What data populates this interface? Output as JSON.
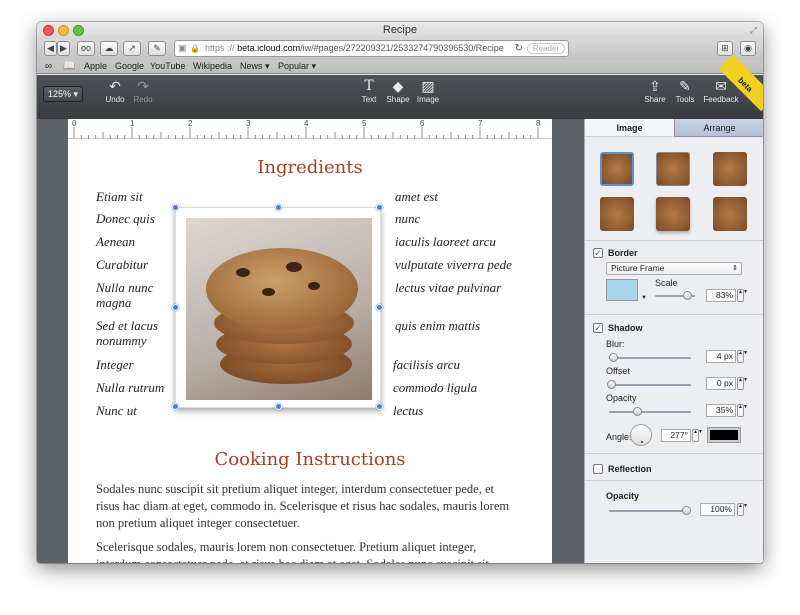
{
  "window": {
    "title": "Recipe"
  },
  "browser": {
    "url_scheme": "https",
    "url_host": "beta.icloud.com",
    "url_path": "/iw/#pages/272209321/2533274790396530/Recipe",
    "reader_label": "Reader"
  },
  "bookmarks": [
    "Apple",
    "Google",
    "YouTube",
    "Wikipedia",
    "News ▾",
    "Popular ▾"
  ],
  "toolbar": {
    "zoom": "125% ▾",
    "undo": "Undo",
    "redo": "Redo",
    "text": "Text",
    "shape": "Shape",
    "image": "Image",
    "share": "Share",
    "tools": "Tools",
    "feedback": "Feedback",
    "beta": "beta"
  },
  "ruler": [
    "0",
    "1",
    "2",
    "3",
    "4",
    "5",
    "6",
    "7",
    "8"
  ],
  "document": {
    "heading1": "Ingredients",
    "left_items": [
      "Etiam sit",
      "Donec quis",
      "Aenean",
      "Curabitur",
      "Nulla nunc magna",
      "Sed et lacus nonummy",
      "Integer",
      "Nulla rutrum",
      "Nunc ut"
    ],
    "right_items": [
      "amet est",
      "nunc",
      "iaculis laoreet arcu",
      "vulputate viverra pede",
      "lectus vitae pulvinar",
      "quis enim mattis",
      "facilisis arcu",
      "commodo ligula",
      "lectus"
    ],
    "heading2": "Cooking Instructions",
    "para1": "Sodales nunc suscipit sit pretium aliquet integer, interdum consectetuer pede, et risus hac diam at eget, commodo in. Scelerisque et risus hac sodales, mauris lorem non pretium aliquet integer consectetuer.",
    "para2": "Scelerisque sodales, mauris lorem non consectetuer. Pretium aliquet integer, interdum consectetuer pede, et risus hac diam at eget. Sodales nunc suscipit sit"
  },
  "panel": {
    "tab_image": "Image",
    "tab_arrange": "Arrange",
    "border_label": "Border",
    "border_style": "Picture Frame",
    "scale_label": "Scale",
    "scale_value": "83%",
    "scale_fraction": 0.83,
    "shadow_label": "Shadow",
    "blur_label": "Blur:",
    "blur_value": "4 px",
    "offset_label": "Offset",
    "offset_value": "0 px",
    "opacity_label": "Opacity",
    "opacity_value": "35%",
    "angle_label": "Angle:",
    "angle_value": "277°",
    "shadow_color": "#000000",
    "reflection_label": "Reflection",
    "reflection_opacity_label": "Opacity",
    "reflection_opacity_value": "100%"
  },
  "colors": {
    "heading": "#a8401f",
    "canvas": "#5d6267",
    "border_swatch": "#a9d4ee"
  }
}
